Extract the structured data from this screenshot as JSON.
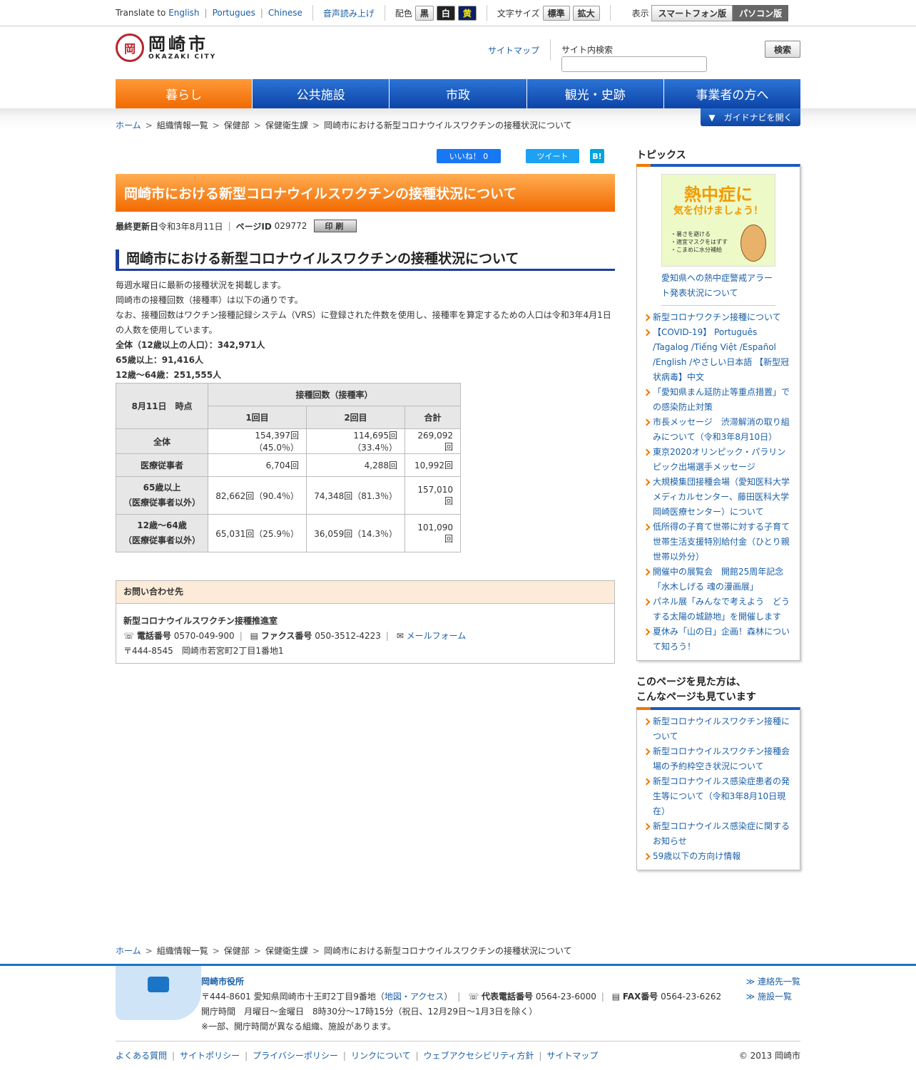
{
  "util": {
    "translate_prefix": "Translate to",
    "lang_en": "English",
    "lang_pt": "Portugues",
    "lang_zh": "Chinese",
    "voice": "音声読み上げ",
    "color_label": "配色",
    "color_black": "黒",
    "color_white": "白",
    "color_yellow": "黄",
    "fontsize_label": "文字サイズ",
    "fontsize_std": "標準",
    "fontsize_large": "拡大",
    "display_label": "表示",
    "display_sp": "スマートフォン版",
    "display_pc": "パソコン版"
  },
  "header": {
    "logo_jp": "岡崎市",
    "logo_en": "OKAZAKI CITY",
    "sitemap": "サイトマップ",
    "search_label": "サイト内検索",
    "search_button": "検索"
  },
  "nav": [
    "暮らし",
    "公共施設",
    "市政",
    "観光・史跡",
    "事業者の方へ"
  ],
  "guide": "▼　ガイドナビを開く",
  "breadcrumb": [
    "ホーム",
    "組織情報一覧",
    "保健部",
    "保健衛生課",
    "岡崎市における新型コロナウイルスワクチンの接種状況について"
  ],
  "social": {
    "like": "いいね！ 0",
    "tweet": "ツイート",
    "hatena": "B!"
  },
  "page": {
    "title": "岡崎市における新型コロナウイルスワクチンの接種状況について",
    "updated_label": "最終更新日",
    "updated": "令和3年8月11日",
    "pageid_label": "ページID",
    "pageid": "029772",
    "print": "印刷",
    "h2": "岡崎市における新型コロナウイルスワクチンの接種状況について",
    "p1": "毎週水曜日に最新の接種状況を掲載します。",
    "p2": "岡崎市の接種回数（接種率）は以下の通りです。",
    "p3": "なお、接種回数はワクチン接種記録システム（VRS）に登録された件数を使用し、接種率を算定するための人口は令和3年4月1日の人数を使用しています。",
    "pop_all": "全体（12歳以上の人口）：342,971人",
    "pop_65": "65歳以上：91,416人",
    "pop_12": "12歳～64歳：251,555人"
  },
  "table": {
    "corner": "8月11日　時点",
    "group": "接種回数（接種率）",
    "cols": [
      "1回目",
      "2回目",
      "合計"
    ],
    "rows": [
      {
        "h1": "全体",
        "h2": "",
        "c": [
          "154,397回（45.0％）",
          "114,695回（33.4％）",
          "269,092回"
        ]
      },
      {
        "h1": "医療従事者",
        "h2": "",
        "c": [
          "6,704回",
          "4,288回",
          "10,992回"
        ]
      },
      {
        "h1": "65歳以上",
        "h2": "（医療従事者以外）",
        "c": [
          "82,662回（90.4％）",
          "74,348回（81.3％）",
          "157,010回"
        ]
      },
      {
        "h1": "12歳～64歳",
        "h2": "（医療従事者以外）",
        "c": [
          "65,031回（25.9％）",
          "36,059回（14.3％）",
          "101,090回"
        ]
      }
    ]
  },
  "contact": {
    "head": "お問い合わせ先",
    "dept": "新型コロナウイルスワクチン接種推進室",
    "tel_label": "電話番号",
    "tel": "0570-049-900",
    "fax_label": "ファクス番号",
    "fax": "050-3512-4223",
    "mail": "メールフォーム",
    "addr": "〒444-8545　岡崎市若宮町2丁目1番地1"
  },
  "topics": {
    "head": "トピックス",
    "banner_title": "熱中症に",
    "banner_title2": "気を付けましょう！",
    "banner_l1": "・暑さを避ける",
    "banner_l2": "・適宜マスクをはずす",
    "banner_l3": "・こまめに水分補給",
    "banner_link": "愛知県への熱中症警戒アラート発表状況について",
    "items": [
      "新型コロナワクチン接種について",
      "【COVID-19】 Português /Tagalog /Tiếng Việt /Español /English /やさしい日本語 【新型冠状病毒】中文",
      "「愛知県まん延防止等重点措置」での感染防止対策",
      "市長メッセージ　渋滞解消の取り組みについて（令和3年8月10日）",
      "東京2020オリンピック・パラリンピック出場選手メッセージ",
      "大規模集団接種会場（愛知医科大学メディカルセンター、藤田医科大学岡崎医療センター）について",
      "低所得の子育て世帯に対する子育て世帯生活支援特別給付金（ひとり親世帯以外分）",
      "開催中の展覧会　開館25周年記念「水木しげる 魂の漫画展」",
      "パネル展「みんなで考えよう　どうする太陽の城跡地」を開催します",
      "夏休み「山の日」企画！森林について知ろう！"
    ]
  },
  "related": {
    "head1": "このページを見た方は、",
    "head2": "こんなページも見ています",
    "items": [
      "新型コロナウイルスワクチン接種について",
      "新型コロナウイルスワクチン接種会場の予約枠空き状況について",
      "新型コロナウイルス感染症患者の発生等について（令和3年8月10日現在）",
      "新型コロナウイルス感染症に関するお知らせ",
      "59歳以下の方向け情報"
    ]
  },
  "footer": {
    "office": "岡崎市役所",
    "addr": "〒444-8601 愛知県岡崎市十王町2丁目9番地（",
    "map": "地図・アクセス",
    "addr_end": "）",
    "tel_label": "代表電話番号",
    "tel": "0564-23-6000",
    "fax_label": "FAX番号",
    "fax": "0564-23-6262",
    "hours": "開庁時間　月曜日～金曜日　8時30分～17時15分（祝日、12月29日～1月3日を除く）",
    "note": "※一部、開庁時間が異なる組織、施設があります。",
    "contacts": "≫ 連絡先一覧",
    "facilities": "≫ 施設一覧",
    "links": [
      "よくある質問",
      "サイトポリシー",
      "プライバシーポリシー",
      "リンクについて",
      "ウェブアクセシビリティ方針",
      "サイトマップ"
    ],
    "copyright": "© 2013 岡崎市"
  }
}
